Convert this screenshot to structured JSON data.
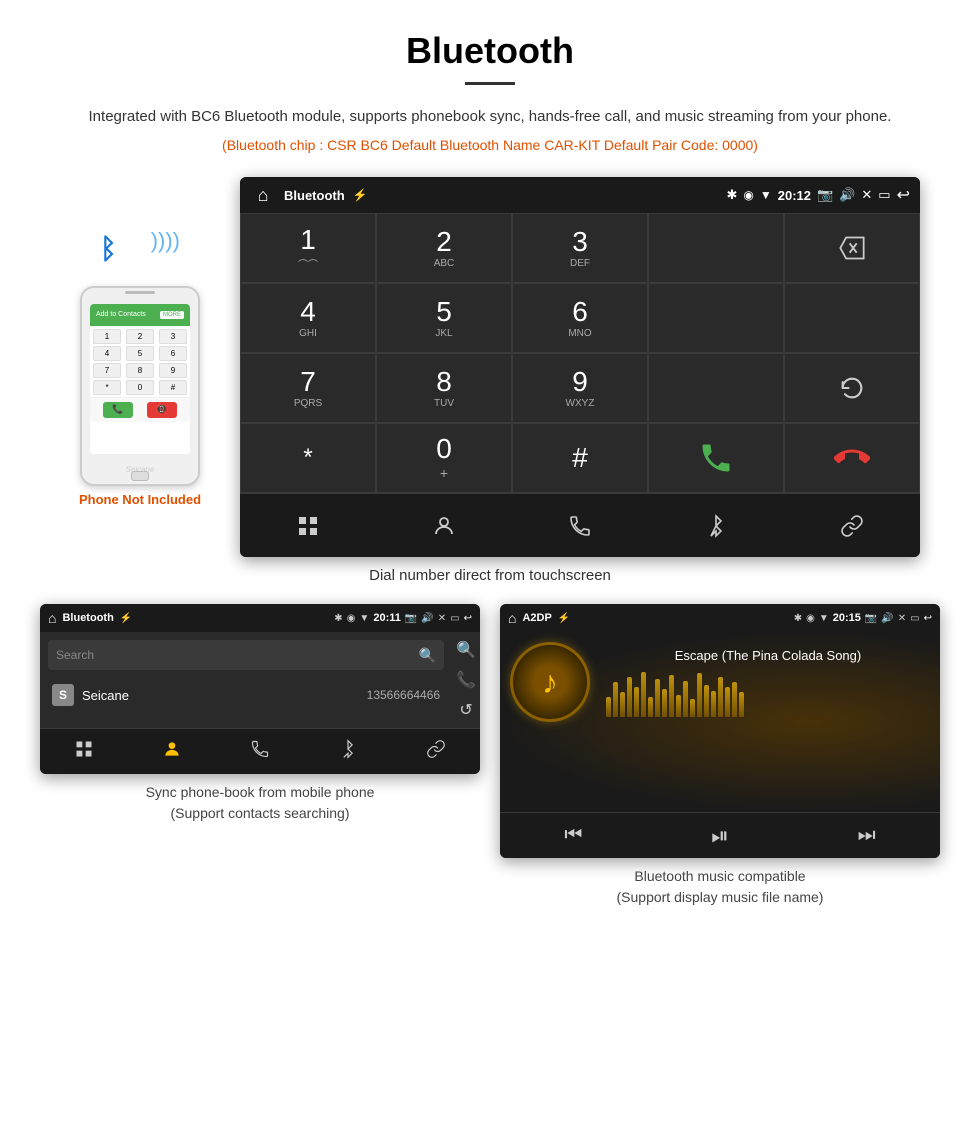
{
  "page": {
    "title": "Bluetooth",
    "description": "Integrated with BC6 Bluetooth module, supports phonebook sync, hands-free call, and music streaming from your phone.",
    "specs": "(Bluetooth chip : CSR BC6    Default Bluetooth Name CAR-KIT    Default Pair Code: 0000)",
    "dial_caption": "Dial number direct from touchscreen",
    "phonebook_caption": "Sync phone-book from mobile phone\n(Support contacts searching)",
    "music_caption": "Bluetooth music compatible\n(Support display music file name)"
  },
  "phone_aside": {
    "not_included": "Phone Not Included"
  },
  "car_screen": {
    "status": {
      "app_name": "Bluetooth",
      "time": "20:12"
    },
    "dialpad": [
      {
        "num": "1",
        "sub": "⌒⌒"
      },
      {
        "num": "2",
        "sub": "ABC"
      },
      {
        "num": "3",
        "sub": "DEF"
      },
      {
        "num": "",
        "sub": ""
      },
      {
        "num": "⌫",
        "sub": ""
      },
      {
        "num": "4",
        "sub": "GHI"
      },
      {
        "num": "5",
        "sub": "JKL"
      },
      {
        "num": "6",
        "sub": "MNO"
      },
      {
        "num": "",
        "sub": ""
      },
      {
        "num": "",
        "sub": ""
      },
      {
        "num": "7",
        "sub": "PQRS"
      },
      {
        "num": "8",
        "sub": "TUV"
      },
      {
        "num": "9",
        "sub": "WXYZ"
      },
      {
        "num": "",
        "sub": ""
      },
      {
        "num": "↺",
        "sub": ""
      },
      {
        "num": "*",
        "sub": ""
      },
      {
        "num": "0",
        "sub": "+"
      },
      {
        "num": "#",
        "sub": ""
      },
      {
        "num": "📞",
        "sub": ""
      },
      {
        "num": "📵",
        "sub": ""
      }
    ]
  },
  "phonebook_screen": {
    "status": {
      "app_name": "Bluetooth",
      "time": "20:11"
    },
    "search_placeholder": "Search",
    "contacts": [
      {
        "letter": "S",
        "name": "Seicane",
        "number": "13566664466"
      }
    ]
  },
  "music_screen": {
    "status": {
      "app_name": "A2DP",
      "time": "20:15"
    },
    "song_title": "Escape (The Pina Colada Song)",
    "viz_heights": [
      20,
      35,
      25,
      40,
      30,
      45,
      20,
      38,
      28,
      42,
      22,
      36,
      18,
      44,
      32,
      26,
      40,
      30,
      35,
      25
    ]
  },
  "icons": {
    "bluetooth": "⚡",
    "home": "⌂",
    "back": "←",
    "usb": "⚙",
    "signal": "▲",
    "wifi": "▲",
    "battery": "▮",
    "camera": "📷",
    "volume": "🔊",
    "close": "✕",
    "window": "▭",
    "grid": "⊞",
    "user": "👤",
    "phone": "📞",
    "bt": "⚡",
    "link": "🔗",
    "search": "🔍",
    "call": "📞",
    "refresh": "↺",
    "prev": "⏮",
    "play_pause": "⏯",
    "next": "⏭"
  }
}
